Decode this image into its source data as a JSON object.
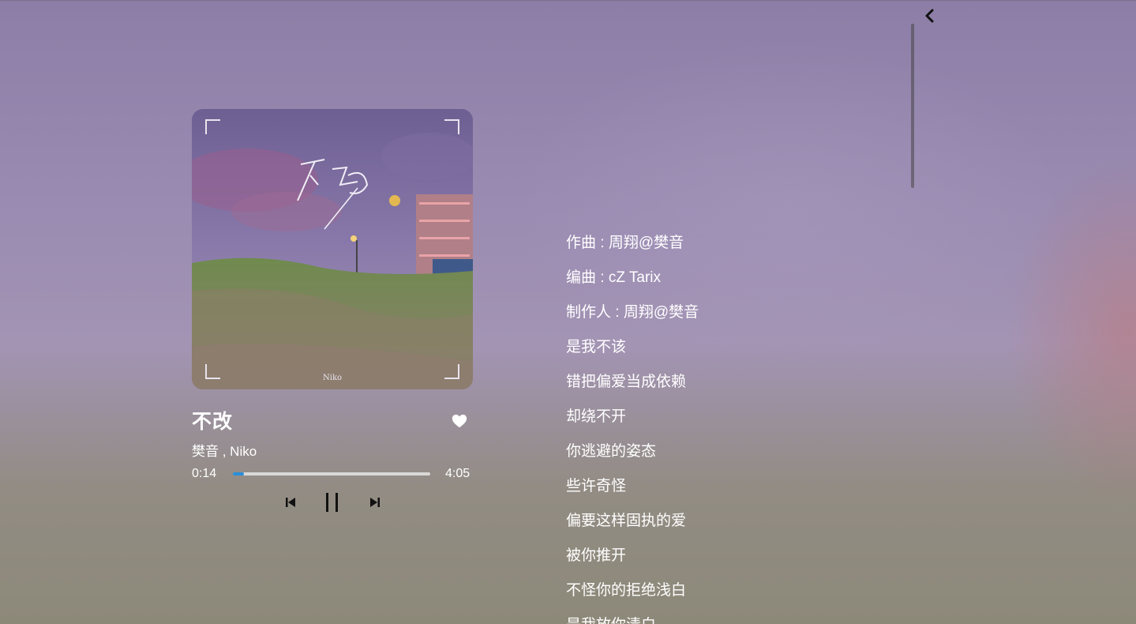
{
  "song": {
    "title": "不改",
    "artists": "樊音 , Niko",
    "current_time": "0:14",
    "total_time": "4:05",
    "progress": 0.057,
    "liked": true,
    "accent_color": "#2b8fd8"
  },
  "cover": {
    "title_text": "不改",
    "signature": "Niko"
  },
  "controls": {
    "back_icon": "chevron-left-icon",
    "prev_icon": "skip-previous-icon",
    "play_icon": "pause-icon",
    "next_icon": "skip-next-icon",
    "like_icon": "heart-icon"
  },
  "lyrics": [
    "作曲 : 周翔@樊音",
    "编曲 : cZ Tarix",
    "制作人 : 周翔@樊音",
    "是我不该",
    "错把偏爱当成依赖",
    "却绕不开",
    "你逃避的姿态",
    "些许奇怪",
    "偏要这样固执的爱",
    "被你推开",
    "不怪你的拒绝浅白",
    "是我放你清白"
  ]
}
